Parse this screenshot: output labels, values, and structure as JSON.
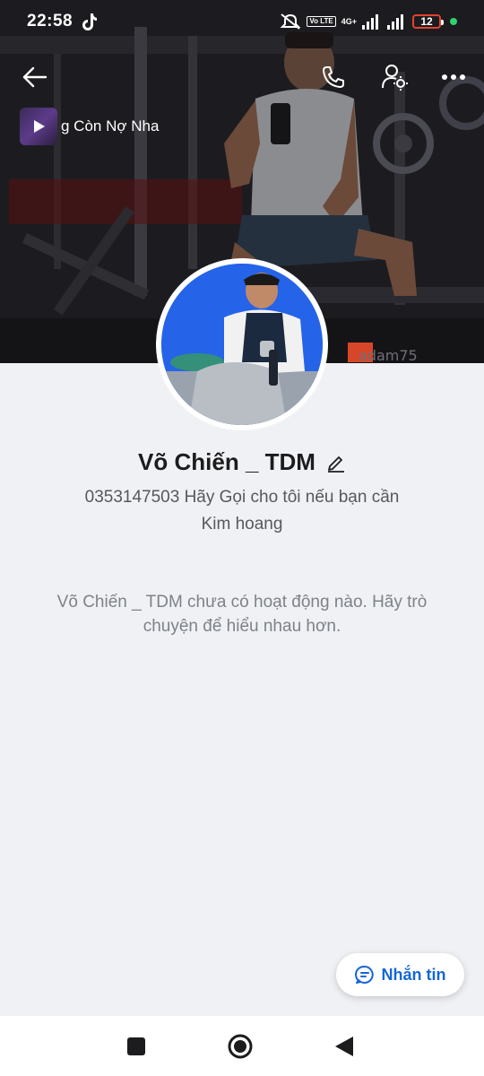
{
  "status_bar": {
    "time": "22:58",
    "volte_label": "Vo LTE",
    "network_label": "4G+",
    "battery_level": "12",
    "battery_color": "#e0442e",
    "icons": [
      "tiktok-icon",
      "mute-icon",
      "signal-icon",
      "battery-icon"
    ]
  },
  "top_bar": {
    "icons": [
      "arrow-left-icon",
      "phone-icon",
      "user-settings-icon",
      "more-horizontal-icon"
    ]
  },
  "music": {
    "title": "g Còn Nợ Nha",
    "icon": "play-icon"
  },
  "cover": {
    "watermark": "adam75"
  },
  "profile": {
    "name": "Võ Chiến _ TDM",
    "bio_line1": "0353147503 Hãy Gọi cho tôi nếu bạn cần",
    "bio_line2": "Kim hoang"
  },
  "feed": {
    "empty_message": "Võ Chiến _ TDM chưa có hoạt động nào. Hãy trò chuyện để hiểu nhau hơn."
  },
  "actions": {
    "message_label": "Nhắn tin",
    "accent_color": "#1565d8"
  },
  "nav_bar": {
    "icons": [
      "recents-square-icon",
      "home-circle-icon",
      "back-triangle-icon"
    ]
  }
}
